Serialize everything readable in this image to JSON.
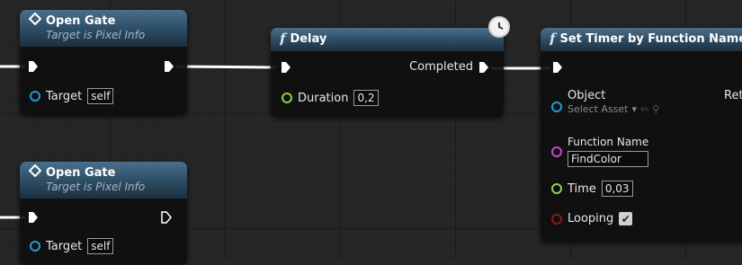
{
  "nodes": {
    "open_gate_1": {
      "title": "Open Gate",
      "subtitle": "Target is Pixel Info",
      "target_label": "Target",
      "target_value": "self"
    },
    "open_gate_2": {
      "title": "Open Gate",
      "subtitle": "Target is Pixel Info",
      "target_label": "Target",
      "target_value": "self"
    },
    "delay": {
      "title": "Delay",
      "completed_label": "Completed",
      "duration_label": "Duration",
      "duration_value": "0,2"
    },
    "set_timer": {
      "title": "Set Timer by Function Name",
      "object_label": "Object",
      "object_placeholder": "Select Asset",
      "return_label_partial": "Ret",
      "function_name_label": "Function Name",
      "function_name_value": "FindColor",
      "time_label": "Time",
      "time_value": "0,03",
      "looping_label": "Looping",
      "looping_checked": true
    }
  },
  "colors": {
    "object_pin": "#1e9bd6",
    "float_pin": "#8bd34a",
    "name_pin": "#c844c8",
    "bool_pin": "#8a1a1a",
    "exec": "#ffffff"
  },
  "icons": [
    "diamond-event-icon",
    "function-icon",
    "clock-icon",
    "exec-pin-icon",
    "dropdown-arrow-icon",
    "use-selected-arrow-icon",
    "browse-icon",
    "checkmark-icon"
  ]
}
